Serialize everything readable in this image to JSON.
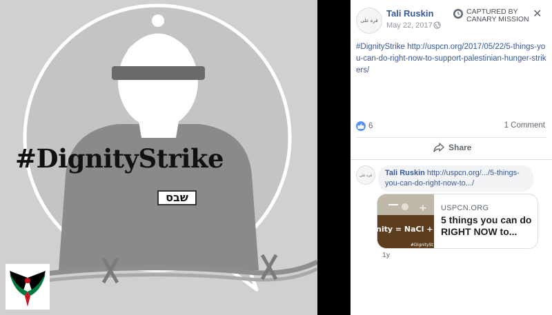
{
  "image": {
    "hashtag": "#DignityStrike",
    "badge_text": "שבס"
  },
  "post": {
    "author": "Tali Ruskin",
    "avatar_text": "قرة على بالي",
    "date": "May 22, 2017 ·",
    "captured_label": "CAPTURED BY CANARY MISSION",
    "hashtag": "#DignityStrike",
    "link_text": " http://uspcn.org/2017/05/22/5-things-you-can-do-right-now-to-support-palestinian-hunger-strikers/",
    "like_count": "6",
    "comment_count": "1 Comment",
    "share_label": "Share"
  },
  "comment": {
    "author": "Tali Ruskin",
    "link_text": " http://uspcn.org/.../5-things-you-can-do-right-now-to.../",
    "card_domain": "USPCN.ORG",
    "card_title": "5 things you can do RIGHT NOW to...",
    "card_image_text": "nity = NaCl + H",
    "card_image_tag": "#DignitySt",
    "time_ago": "1y"
  },
  "colors": {
    "link_blue": "#365899",
    "like_blue": "#5890ff",
    "flag_green": "#007a3d",
    "flag_red": "#ce1126"
  }
}
